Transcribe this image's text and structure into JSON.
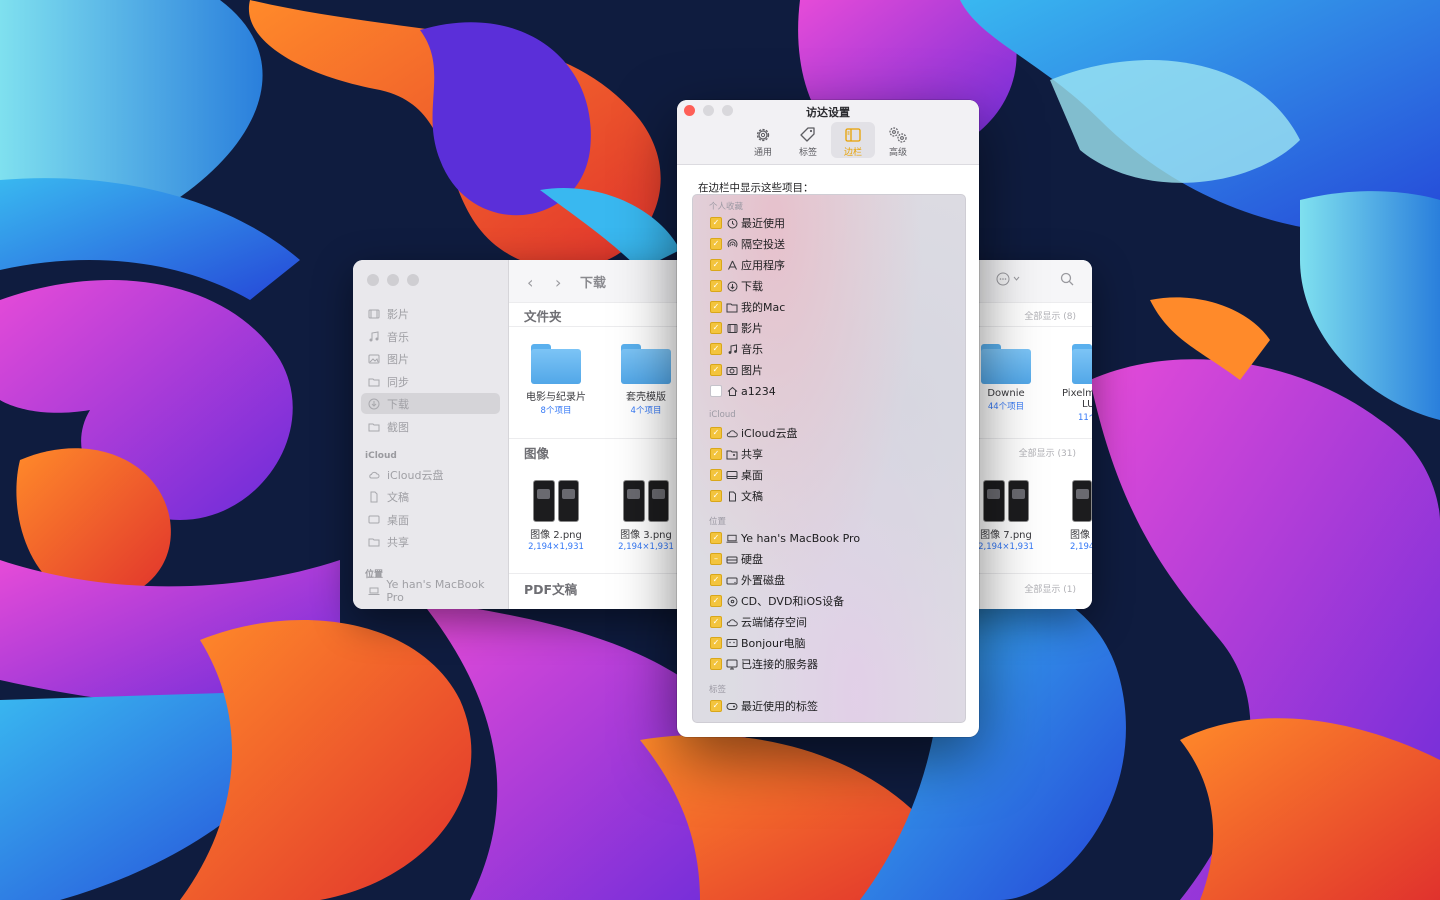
{
  "finder": {
    "title": "下载",
    "sidebar": {
      "favorites": [
        {
          "label": "影片",
          "icon": "film-icon"
        },
        {
          "label": "音乐",
          "icon": "music-icon"
        },
        {
          "label": "图片",
          "icon": "photo-icon"
        },
        {
          "label": "同步",
          "icon": "folder-icon"
        },
        {
          "label": "下载",
          "icon": "download-icon",
          "active": true
        },
        {
          "label": "截图",
          "icon": "folder-icon"
        }
      ],
      "icloud_header": "iCloud",
      "icloud": [
        {
          "label": "iCloud云盘",
          "icon": "cloud-icon"
        },
        {
          "label": "文稿",
          "icon": "document-icon"
        },
        {
          "label": "桌面",
          "icon": "desktop-icon"
        },
        {
          "label": "共享",
          "icon": "shared-folder-icon"
        }
      ],
      "locations_header": "位置",
      "locations": [
        {
          "label": "Ye han's MacBook Pro",
          "icon": "laptop-icon"
        }
      ]
    },
    "sections": {
      "folders": {
        "title": "文件夹",
        "show_all": "全部显示 (8)"
      },
      "images": {
        "title": "图像",
        "show_all": "全部显示 (31)"
      },
      "pdf": {
        "title": "PDF文稿",
        "show_all": "全部显示 (1)"
      }
    },
    "folders": [
      {
        "name": "电影与纪录片",
        "sub": "8个项目"
      },
      {
        "name": "套壳模版",
        "sub": "4个项目"
      },
      {
        "name": "Downie",
        "sub": "44个项目"
      },
      {
        "name": "Pixelm",
        "sub2": "LU",
        "sub": "11个"
      }
    ],
    "images": [
      {
        "name": "图像 2.png",
        "sub": "2,194×1,931"
      },
      {
        "name": "图像 3.png",
        "sub": "2,194×1,931"
      },
      {
        "name": "图像 7.png",
        "sub": "2,194×1,931"
      },
      {
        "name": "图像",
        "sub": "2,194"
      }
    ]
  },
  "prefs": {
    "title": "访达设置",
    "tabs": [
      {
        "label": "通用",
        "icon": "gear-icon"
      },
      {
        "label": "标签",
        "icon": "tag-icon"
      },
      {
        "label": "边栏",
        "icon": "sidebar-icon",
        "selected": true
      },
      {
        "label": "高级",
        "icon": "gears-icon"
      }
    ],
    "heading": "在边栏中显示这些项目：",
    "groups": {
      "favorites": "个人收藏",
      "icloud": "iCloud",
      "locations": "位置",
      "tags": "标签"
    },
    "favorites": [
      {
        "label": "最近使用",
        "icon": "clock-icon",
        "checked": true
      },
      {
        "label": "隔空投送",
        "icon": "airdrop-icon",
        "checked": true
      },
      {
        "label": "应用程序",
        "icon": "apps-icon",
        "checked": true
      },
      {
        "label": "下载",
        "icon": "download-icon",
        "checked": true
      },
      {
        "label": "我的Mac",
        "icon": "folder-icon",
        "checked": true
      },
      {
        "label": "影片",
        "icon": "film-icon",
        "checked": true
      },
      {
        "label": "音乐",
        "icon": "music-icon",
        "checked": true
      },
      {
        "label": "图片",
        "icon": "camera-icon",
        "checked": true
      },
      {
        "label": "a1234",
        "icon": "home-icon",
        "checked": false
      }
    ],
    "icloud": [
      {
        "label": "iCloud云盘",
        "icon": "cloud-icon",
        "checked": true
      },
      {
        "label": "共享",
        "icon": "shared-folder-icon",
        "checked": true
      },
      {
        "label": "桌面",
        "icon": "desktop-icon",
        "checked": true
      },
      {
        "label": "文稿",
        "icon": "document-icon",
        "checked": true
      }
    ],
    "locations": [
      {
        "label": "Ye han's MacBook Pro",
        "icon": "laptop-icon",
        "checked": true
      },
      {
        "label": "硬盘",
        "icon": "harddisk-icon",
        "checked": "mixed"
      },
      {
        "label": "外置磁盘",
        "icon": "external-disk-icon",
        "checked": true
      },
      {
        "label": "CD、DVD和iOS设备",
        "icon": "disc-icon",
        "checked": true
      },
      {
        "label": "云端储存空间",
        "icon": "cloud-icon",
        "checked": true
      },
      {
        "label": "Bonjour电脑",
        "icon": "bonjour-icon",
        "checked": true
      },
      {
        "label": "已连接的服务器",
        "icon": "server-icon",
        "checked": true
      }
    ],
    "tags": [
      {
        "label": "最近使用的标签",
        "icon": "tag-icon",
        "checked": true
      }
    ]
  },
  "colors": {
    "accent": "#f3c43d",
    "close": "#fe5f57",
    "folder": "#5ab0ee",
    "link": "#3478f6"
  }
}
